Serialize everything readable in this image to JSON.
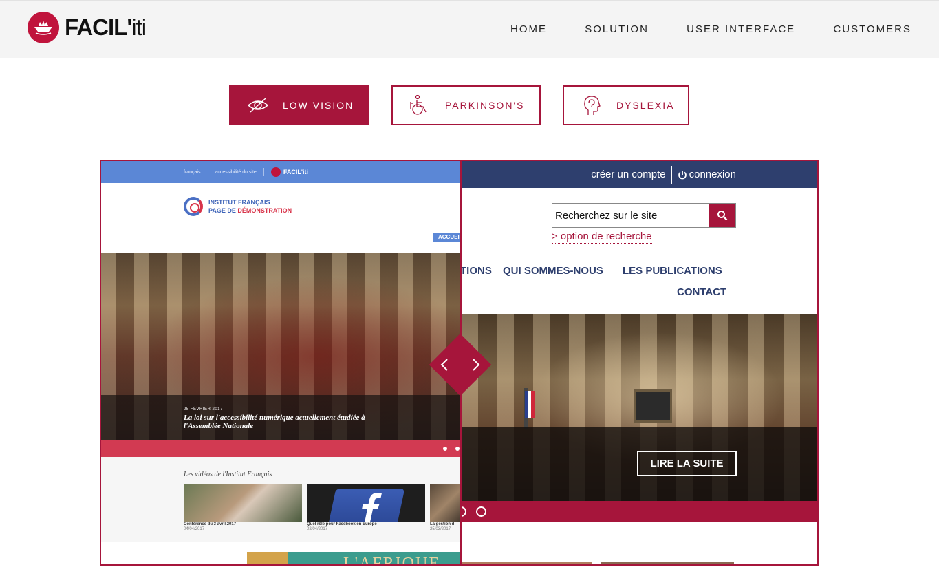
{
  "header": {
    "logo_text_bold": "FACIL'",
    "logo_text_light": "iti",
    "nav": [
      {
        "label": "HOME"
      },
      {
        "label": "SOLUTION"
      },
      {
        "label": "USER INTERFACE"
      },
      {
        "label": "CUSTOMERS"
      }
    ],
    "nav_dash": "–"
  },
  "modes": {
    "low_vision": "LOW VISION",
    "parkinson": "PARKINSON'S",
    "dyslexia": "DYSLEXIA",
    "active": "low_vision"
  },
  "colors": {
    "brand": "#a6153b",
    "left_header": "#5b87d6",
    "right_header": "#2e3f6e"
  },
  "original_site": {
    "top_links": [
      "français",
      "accessibilité du site"
    ],
    "mini_logo": "FACIL'iti",
    "brand_line1": "INSTITUT FRANÇAIS",
    "brand_line2_a": "PAGE DE ",
    "brand_line2_b": "DÉMONSTRATION",
    "accueil": "ACCUEIL",
    "hero_date": "25 FÉVRIER 2017",
    "hero_title_line1": "La loi sur l'accessibilité numérique actuellement étudiée à",
    "hero_title_line2": "l'Assemblée Nationale",
    "videos_title": "Les vidéos de l'Institut Français",
    "videos": [
      {
        "caption": "Conférence du 3 avril 2017",
        "date": "04/04/2017"
      },
      {
        "caption": "Quel rôle pour Facebook en Europe",
        "date": "02/04/2017"
      },
      {
        "caption": "La gestion d",
        "date": "25/03/2017"
      }
    ],
    "banner_text": "L'AFRIQUE"
  },
  "adapted_site": {
    "create_account": "créer un compte",
    "login": "connexion",
    "search_placeholder": "Recherchez sur le site",
    "search_option": "> option de recherche",
    "menu_row1": [
      "TIONS",
      "QUI SOMMES-NOUS",
      "LES PUBLICATIONS"
    ],
    "menu_row2": "CONTACT",
    "read_more": "LIRE LA SUITE"
  },
  "icons": {
    "low_vision": "eye-slash-icon",
    "parkinson": "wheelchair-icon",
    "dyslexia": "head-profile-icon",
    "search": "search-icon",
    "power": "power-icon",
    "slider_left": "chevron-left-icon",
    "slider_right": "chevron-right-icon"
  }
}
